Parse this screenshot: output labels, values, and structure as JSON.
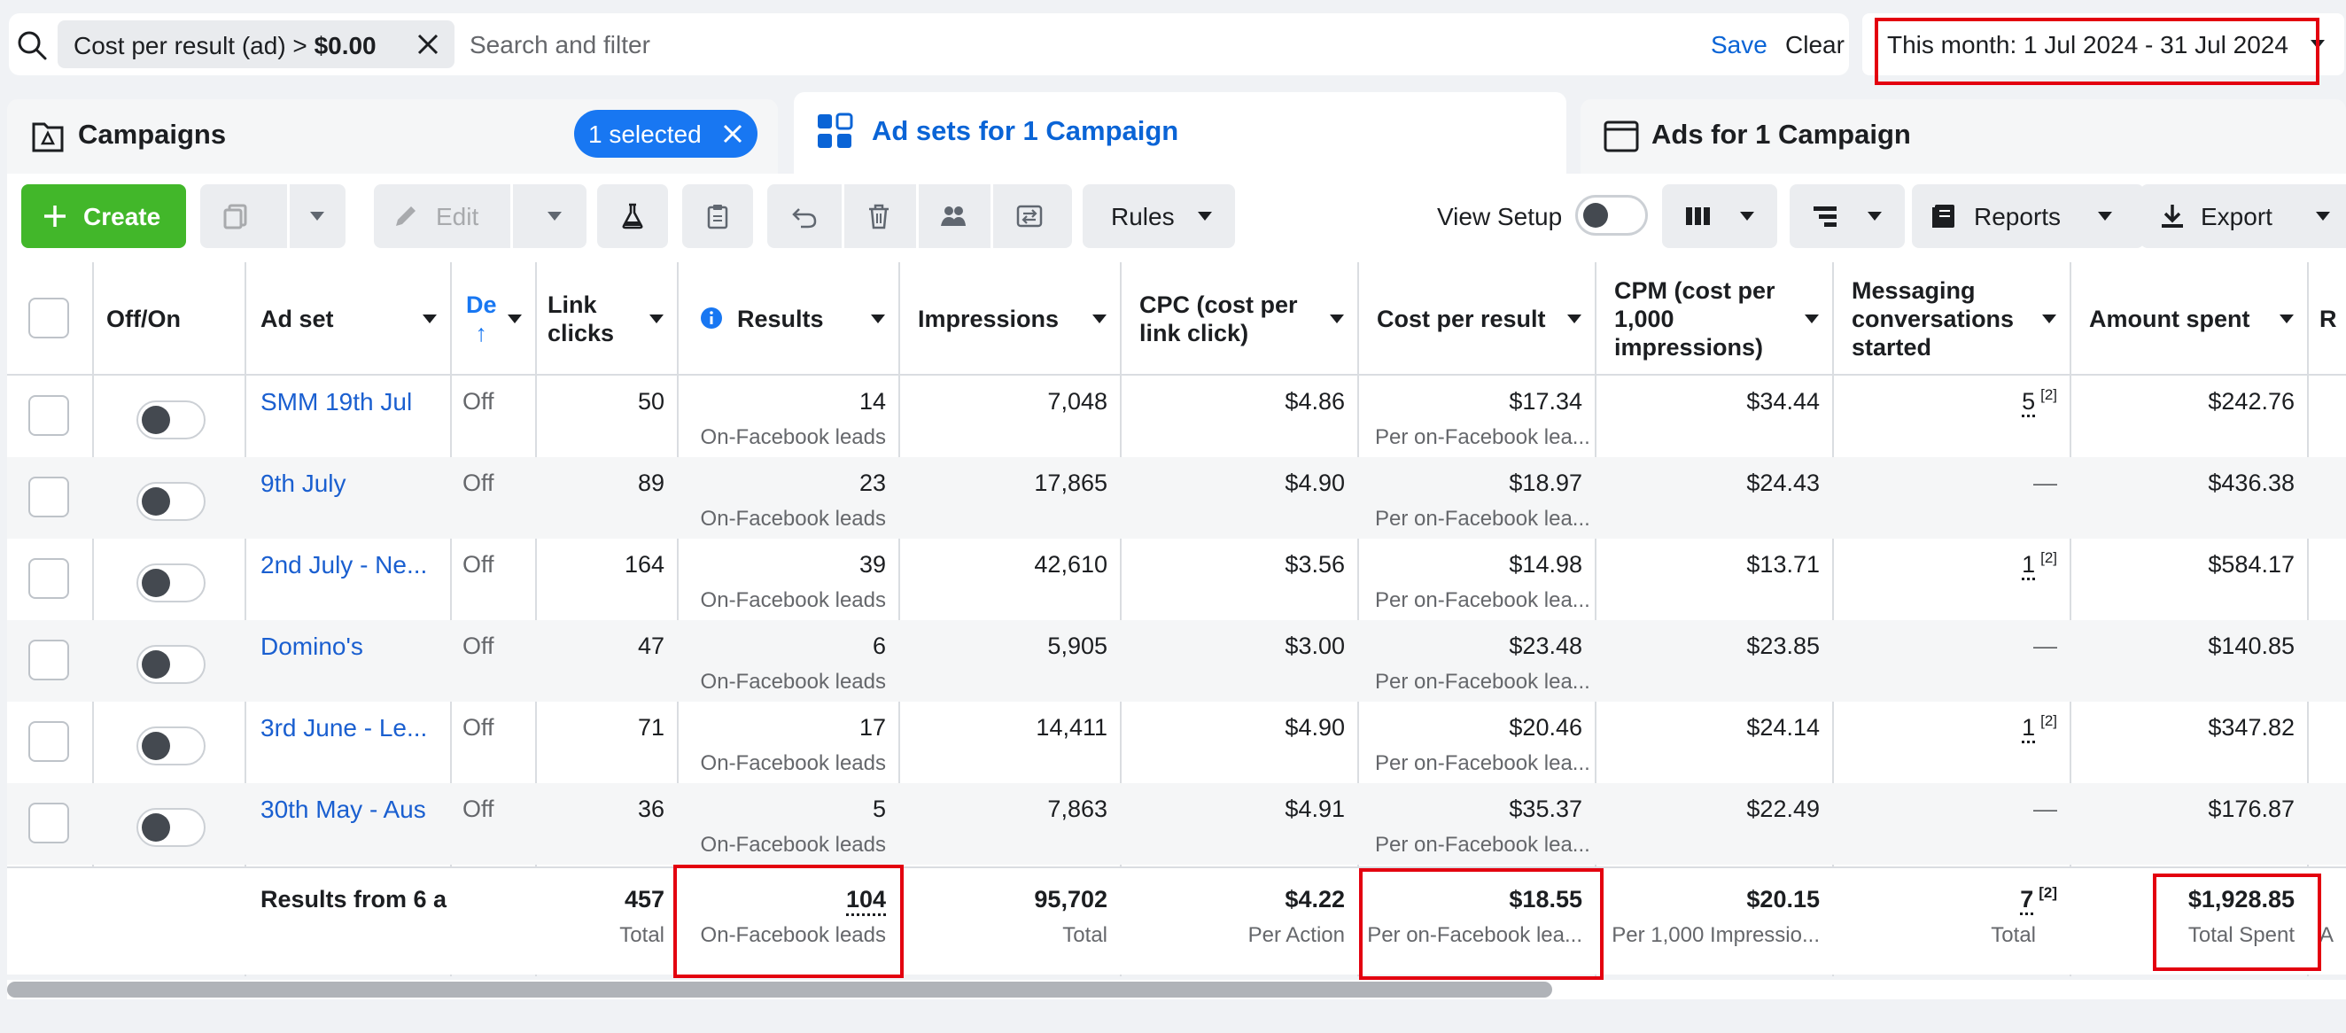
{
  "filter_bar": {
    "filter_chip_label": "Cost per result (ad) > ",
    "filter_chip_value": "$0.00",
    "search_placeholder": "Search and filter",
    "save": "Save",
    "clear": "Clear",
    "date_range": "This month: 1 Jul 2024 - 31 Jul 2024"
  },
  "tabs": {
    "campaigns": "Campaigns",
    "selected_pill": "1 selected",
    "ad_sets": "Ad sets for 1 Campaign",
    "ads": "Ads for 1 Campaign"
  },
  "toolbar": {
    "create": "Create",
    "edit": "Edit",
    "rules": "Rules",
    "view_setup": "View Setup",
    "reports": "Reports",
    "export": "Export"
  },
  "columns": {
    "off_on": "Off/On",
    "ad_set": "Ad set",
    "delivery": "De",
    "link_clicks_1": "Link",
    "link_clicks_2": "clicks",
    "results": "Results",
    "impressions": "Impressions",
    "cpc_1": "CPC (cost per",
    "cpc_2": "link click)",
    "cost_per_result": "Cost per result",
    "cpm_1": "CPM (cost per",
    "cpm_2": "1,000",
    "cpm_3": "impressions)",
    "msg_1": "Messaging",
    "msg_2": "conversations",
    "msg_3": "started",
    "amount_spent": "Amount spent",
    "next_col": "R"
  },
  "rows": [
    {
      "name": "SMM 19th Jul",
      "delivery": "Off",
      "link_clicks": "50",
      "results": "14",
      "results_sub": "On-Facebook leads",
      "impressions": "7,048",
      "cpc": "$4.86",
      "cpr": "$17.34",
      "cpr_sub": "Per on-Facebook lea...",
      "cpm": "$34.44",
      "msg": "5",
      "msg_sup": "[2]",
      "spent": "$242.76"
    },
    {
      "name": "9th July",
      "delivery": "Off",
      "link_clicks": "89",
      "results": "23",
      "results_sub": "On-Facebook leads",
      "impressions": "17,865",
      "cpc": "$4.90",
      "cpr": "$18.97",
      "cpr_sub": "Per on-Facebook lea...",
      "cpm": "$24.43",
      "msg": "—",
      "msg_sup": "",
      "spent": "$436.38"
    },
    {
      "name": "2nd July - Ne...",
      "delivery": "Off",
      "link_clicks": "164",
      "results": "39",
      "results_sub": "On-Facebook leads",
      "impressions": "42,610",
      "cpc": "$3.56",
      "cpr": "$14.98",
      "cpr_sub": "Per on-Facebook lea...",
      "cpm": "$13.71",
      "msg": "1",
      "msg_sup": "[2]",
      "spent": "$584.17"
    },
    {
      "name": "Domino's",
      "delivery": "Off",
      "link_clicks": "47",
      "results": "6",
      "results_sub": "On-Facebook leads",
      "impressions": "5,905",
      "cpc": "$3.00",
      "cpr": "$23.48",
      "cpr_sub": "Per on-Facebook lea...",
      "cpm": "$23.85",
      "msg": "—",
      "msg_sup": "",
      "spent": "$140.85"
    },
    {
      "name": "3rd June - Le...",
      "delivery": "Off",
      "link_clicks": "71",
      "results": "17",
      "results_sub": "On-Facebook leads",
      "impressions": "14,411",
      "cpc": "$4.90",
      "cpr": "$20.46",
      "cpr_sub": "Per on-Facebook lea...",
      "cpm": "$24.14",
      "msg": "1",
      "msg_sup": "[2]",
      "spent": "$347.82"
    },
    {
      "name": "30th May - Aus",
      "delivery": "Off",
      "link_clicks": "36",
      "results": "5",
      "results_sub": "On-Facebook leads",
      "impressions": "7,863",
      "cpc": "$4.91",
      "cpr": "$35.37",
      "cpr_sub": "Per on-Facebook lea...",
      "cpm": "$22.49",
      "msg": "—",
      "msg_sup": "",
      "spent": "$176.87"
    }
  ],
  "totals": {
    "label": "Results from 6 a",
    "link_clicks": "457",
    "link_clicks_sub": "Total",
    "results": "104",
    "results_sub": "On-Facebook leads",
    "impressions": "95,702",
    "impressions_sub": "Total",
    "cpc": "$4.22",
    "cpc_sub": "Per Action",
    "cpr": "$18.55",
    "cpr_sub": "Per on-Facebook lea...",
    "cpm": "$20.15",
    "cpm_sub": "Per 1,000 Impressio...",
    "msg": "7",
    "msg_sup": "[2]",
    "msg_sub": "Total",
    "spent": "$1,928.85",
    "spent_sub": "Total Spent",
    "next_sub": "A"
  },
  "colors": {
    "accent": "#1877f2",
    "create": "#42b72a",
    "highlight": "#e3000f",
    "link": "#1a5fd0"
  }
}
